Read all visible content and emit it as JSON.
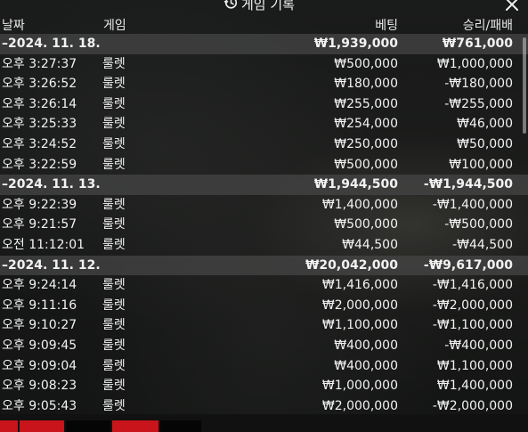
{
  "title": "게임 기록",
  "icons": {
    "history": "history-clock-icon",
    "close": "close-x-icon"
  },
  "columns": {
    "date": "날짜",
    "game": "게임",
    "bet": "베팅",
    "win_loss": "승리/패배"
  },
  "groups": [
    {
      "date": "–2024. 11. 18.",
      "bet_total": "₩1,939,000",
      "win_total": "₩761,000",
      "rows": [
        {
          "time": "오후 3:27:37",
          "game": "룰렛",
          "bet": "₩500,000",
          "result": "₩1,000,000"
        },
        {
          "time": "오후 3:26:52",
          "game": "룰렛",
          "bet": "₩180,000",
          "result": "-₩180,000"
        },
        {
          "time": "오후 3:26:14",
          "game": "룰렛",
          "bet": "₩255,000",
          "result": "-₩255,000"
        },
        {
          "time": "오후 3:25:33",
          "game": "룰렛",
          "bet": "₩254,000",
          "result": "₩46,000"
        },
        {
          "time": "오후 3:24:52",
          "game": "룰렛",
          "bet": "₩250,000",
          "result": "₩50,000"
        },
        {
          "time": "오후 3:22:59",
          "game": "룰렛",
          "bet": "₩500,000",
          "result": "₩100,000"
        }
      ]
    },
    {
      "date": "–2024. 11. 13.",
      "bet_total": "₩1,944,500",
      "win_total": "-₩1,944,500",
      "rows": [
        {
          "time": "오후 9:22:39",
          "game": "룰렛",
          "bet": "₩1,400,000",
          "result": "-₩1,400,000"
        },
        {
          "time": "오후 9:21:57",
          "game": "룰렛",
          "bet": "₩500,000",
          "result": "-₩500,000"
        },
        {
          "time": "오전 11:12:01",
          "game": "룰렛",
          "bet": "₩44,500",
          "result": "-₩44,500"
        }
      ]
    },
    {
      "date": "–2024. 11. 12.",
      "bet_total": "₩20,042,000",
      "win_total": "-₩9,617,000",
      "rows": [
        {
          "time": "오후 9:24:14",
          "game": "룰렛",
          "bet": "₩1,416,000",
          "result": "-₩1,416,000"
        },
        {
          "time": "오후 9:11:16",
          "game": "룰렛",
          "bet": "₩2,000,000",
          "result": "-₩2,000,000"
        },
        {
          "time": "오후 9:10:27",
          "game": "룰렛",
          "bet": "₩1,100,000",
          "result": "-₩1,100,000"
        },
        {
          "time": "오후 9:09:45",
          "game": "룰렛",
          "bet": "₩400,000",
          "result": "-₩400,000"
        },
        {
          "time": "오후 9:09:04",
          "game": "룰렛",
          "bet": "₩400,000",
          "result": "₩1,100,000"
        },
        {
          "time": "오후 9:08:23",
          "game": "룰렛",
          "bet": "₩1,000,000",
          "result": "₩1,400,000"
        },
        {
          "time": "오후 9:05:43",
          "game": "룰렛",
          "bet": "₩2,000,000",
          "result": "-₩2,000,000"
        }
      ]
    }
  ],
  "colors": {
    "group_bg": "#464646",
    "text": "#f2f2f2",
    "strip_red": "#c8141a",
    "strip_black": "#050505"
  }
}
